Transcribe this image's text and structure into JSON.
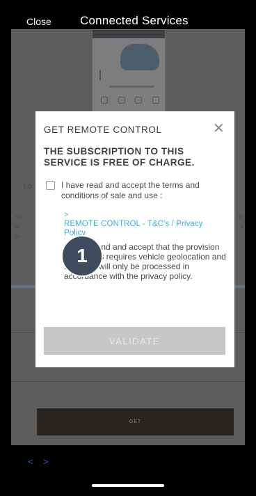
{
  "header": {
    "close_label": "Close",
    "title": "Connected Services"
  },
  "background": {
    "side_left_text": "Yo\nis\nsu",
    "side_right_text": "le\na",
    "heading_fragment": "Lo"
  },
  "modal": {
    "title": "GET REMOTE CONTROL",
    "close_glyph": "✕",
    "subtitle": "THE SUBSCRIPTION TO THIS SERVICE IS FREE OF CHARGE.",
    "terms_label": "I have read and accept the terms and conditions of sale and use :",
    "link_arrow": ">",
    "link_label": "REMOTE CONTROL - T&C's / Privacy Policy",
    "geolocation_text": "I understand and accept that the provision of services requires vehicle geolocation and that data will only be processed in accordance with the privacy policy.",
    "validate_label": "VALIDATE"
  },
  "get_button": "GET",
  "nav": {
    "back_glyph": "<",
    "forward_glyph": ">"
  },
  "step_badge": "1",
  "colors": {
    "link": "#3aaee6",
    "validate_disabled": "#c6c6c6",
    "badge": "#3f4c60",
    "nav_arrows": "#2d5fa8"
  },
  "icons": [
    "close-x-icon",
    "checkbox-icon",
    "chevron-left-icon",
    "chevron-right-icon"
  ]
}
